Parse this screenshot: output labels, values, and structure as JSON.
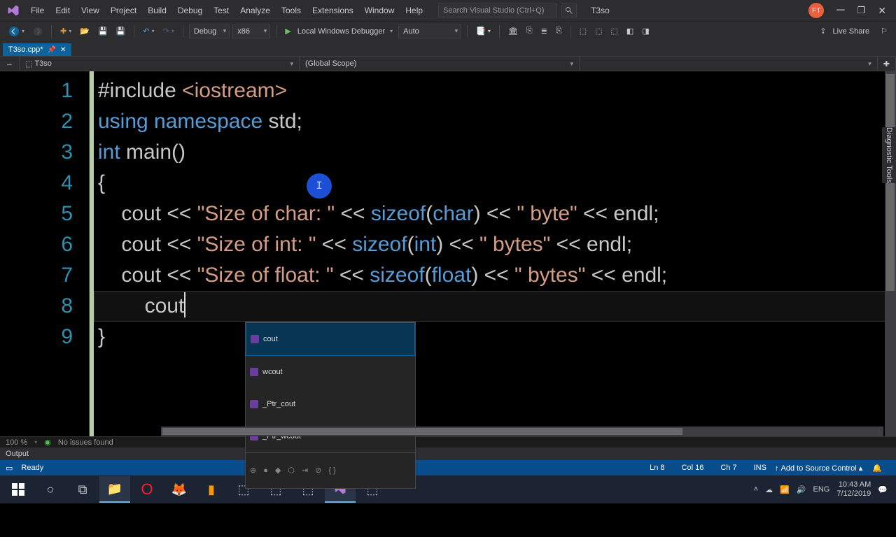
{
  "menubar": {
    "items": [
      "File",
      "Edit",
      "View",
      "Project",
      "Build",
      "Debug",
      "Test",
      "Analyze",
      "Tools",
      "Extensions",
      "Window",
      "Help"
    ],
    "search_placeholder": "Search Visual Studio (Ctrl+Q)",
    "project_name": "T3so",
    "avatar_initials": "FT"
  },
  "toolbar": {
    "config": "Debug",
    "platform": "x86",
    "debugger": "Local Windows Debugger",
    "auto": "Auto",
    "live_share": "Live Share"
  },
  "tab": {
    "label": "T3so.cpp*",
    "pinned": false
  },
  "context": {
    "left_label": "T3so",
    "scope": "(Global Scope)"
  },
  "code": {
    "lines": [
      {
        "num": "1",
        "segments": [
          {
            "t": "#include ",
            "c": "fn"
          },
          {
            "t": "<iostream>",
            "c": "str"
          }
        ]
      },
      {
        "num": "2",
        "segments": [
          {
            "t": "using namespace ",
            "c": "kw"
          },
          {
            "t": "std",
            "c": "fn"
          },
          {
            "t": ";",
            "c": "fn"
          }
        ]
      },
      {
        "num": "3",
        "segments": [
          {
            "t": "int ",
            "c": "kw"
          },
          {
            "t": "main()",
            "c": "fn"
          }
        ]
      },
      {
        "num": "4",
        "segments": [
          {
            "t": "{",
            "c": "fn"
          }
        ]
      },
      {
        "num": "5",
        "segments": [
          {
            "t": "    cout << ",
            "c": "fn"
          },
          {
            "t": "\"Size of char: \"",
            "c": "str"
          },
          {
            "t": " << ",
            "c": "fn"
          },
          {
            "t": "sizeof",
            "c": "kw"
          },
          {
            "t": "(",
            "c": "fn"
          },
          {
            "t": "char",
            "c": "kw"
          },
          {
            "t": ") << ",
            "c": "fn"
          },
          {
            "t": "\" byte\"",
            "c": "str"
          },
          {
            "t": " << endl;",
            "c": "fn"
          }
        ]
      },
      {
        "num": "6",
        "segments": [
          {
            "t": "    cout << ",
            "c": "fn"
          },
          {
            "t": "\"Size of int: \"",
            "c": "str"
          },
          {
            "t": " << ",
            "c": "fn"
          },
          {
            "t": "sizeof",
            "c": "kw"
          },
          {
            "t": "(",
            "c": "fn"
          },
          {
            "t": "int",
            "c": "kw"
          },
          {
            "t": ") << ",
            "c": "fn"
          },
          {
            "t": "\" bytes\"",
            "c": "str"
          },
          {
            "t": " << endl;",
            "c": "fn"
          }
        ]
      },
      {
        "num": "7",
        "segments": [
          {
            "t": "    cout << ",
            "c": "fn"
          },
          {
            "t": "\"Size of float: \"",
            "c": "str"
          },
          {
            "t": " << ",
            "c": "fn"
          },
          {
            "t": "sizeof",
            "c": "kw"
          },
          {
            "t": "(",
            "c": "fn"
          },
          {
            "t": "float",
            "c": "kw"
          },
          {
            "t": ") << ",
            "c": "fn"
          },
          {
            "t": "\" bytes\"",
            "c": "str"
          },
          {
            "t": " << endl;",
            "c": "fn"
          }
        ]
      },
      {
        "num": "8",
        "segments": [
          {
            "t": "        cout",
            "c": "fn"
          }
        ],
        "caret": true
      },
      {
        "num": "9",
        "segments": [
          {
            "t": "}",
            "c": "fn"
          }
        ]
      }
    ]
  },
  "intellisense": {
    "items": [
      "cout",
      "wcout",
      "_Ptr_cout",
      "_Ptr_wcout"
    ],
    "selected_index": 0
  },
  "zoombar": {
    "zoom": "100 %",
    "issues": "No issues found"
  },
  "output_bar": {
    "label": "Output"
  },
  "statusbar": {
    "ready": "Ready",
    "line": "Ln 8",
    "col": "Col 16",
    "ch": "Ch 7",
    "ins": "INS",
    "add_to": "Add to Source Control"
  },
  "right_rail": "Diagnostic Tools",
  "taskbar": {
    "tray": {
      "lang": "ENG",
      "time": "10:43 AM",
      "date": "7/12/2019"
    }
  }
}
